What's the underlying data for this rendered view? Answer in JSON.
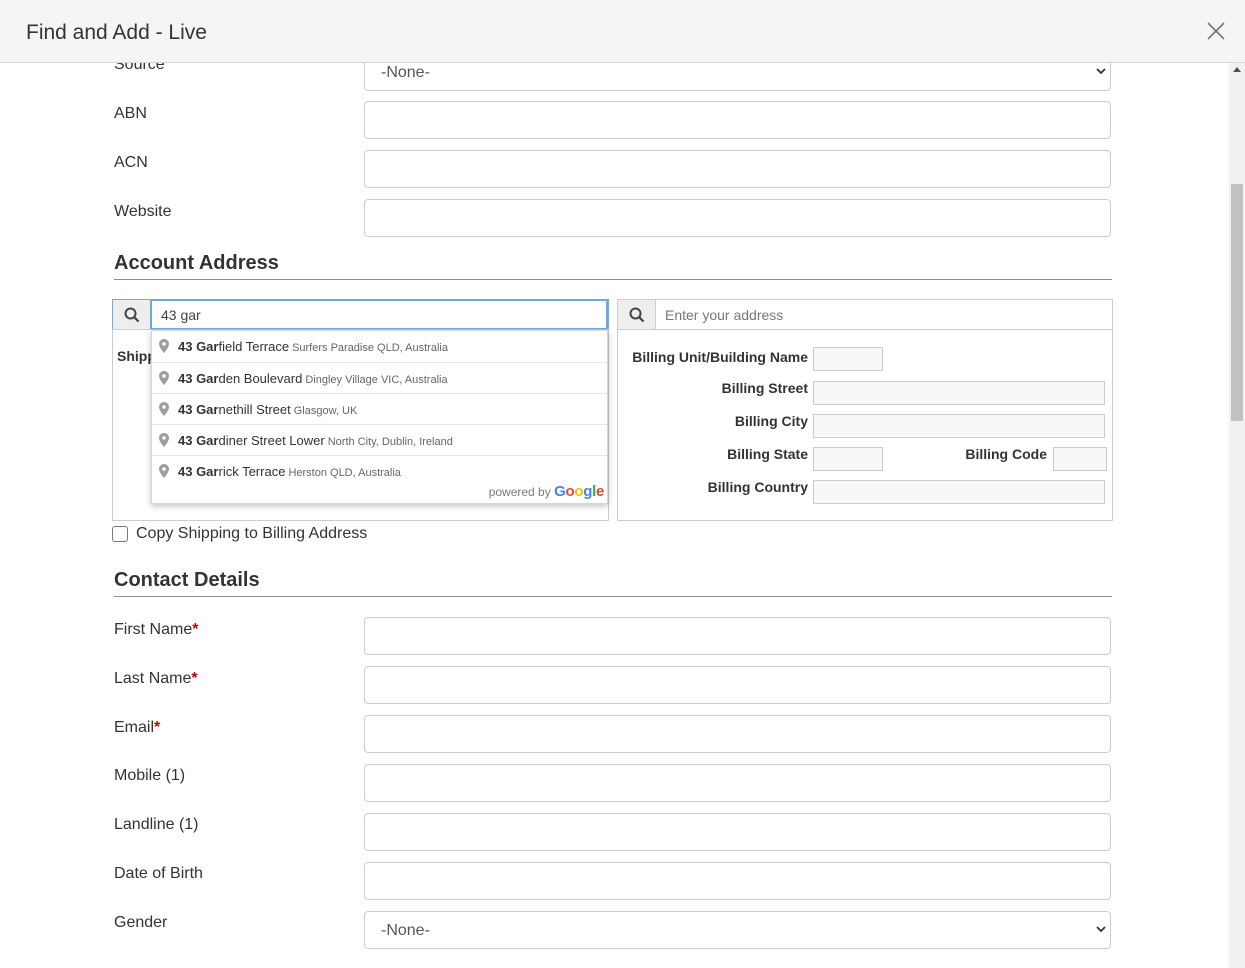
{
  "modal": {
    "title": "Find and Add - Live"
  },
  "account_fields": [
    {
      "label": "Source",
      "type": "select",
      "value": "-None-"
    },
    {
      "label": "ABN",
      "type": "text",
      "value": ""
    },
    {
      "label": "ACN",
      "type": "text",
      "value": ""
    },
    {
      "label": "Website",
      "type": "text",
      "value": ""
    }
  ],
  "account_address": {
    "heading": "Account Address",
    "shipping_search": {
      "value": "43 gar",
      "placeholder": ""
    },
    "billing_search": {
      "value": "",
      "placeholder": "Enter your address"
    },
    "shipping_label_partial": "Shipp",
    "billing_fields": {
      "unit": "Billing Unit/Building Name",
      "street": "Billing Street",
      "city": "Billing City",
      "state": "Billing State",
      "code": "Billing Code",
      "country": "Billing Country"
    },
    "suggestions": [
      {
        "typed": "43 Gar",
        "rest": "field Terrace",
        "secondary": "Surfers Paradise QLD, Australia"
      },
      {
        "typed": "43 Gar",
        "rest": "den Boulevard",
        "secondary": "Dingley Village VIC, Australia"
      },
      {
        "typed": "43 Gar",
        "rest": "nethill Street",
        "secondary": "Glasgow, UK"
      },
      {
        "typed": "43 Gar",
        "rest": "diner Street Lower",
        "secondary": "North City, Dublin, Ireland"
      },
      {
        "typed": "43 Gar",
        "rest": "rick Terrace",
        "secondary": "Herston QLD, Australia"
      }
    ],
    "powered_by": "powered by",
    "google_letters": [
      "G",
      "o",
      "o",
      "g",
      "l",
      "e"
    ],
    "google_colors": [
      "#4285F4",
      "#EA4335",
      "#FBBC05",
      "#4285F4",
      "#34A853",
      "#EA4335"
    ],
    "copy_checkbox": {
      "label": "Copy Shipping to Billing Address",
      "checked": false
    }
  },
  "contact_details": {
    "heading": "Contact Details",
    "fields": [
      {
        "label": "First Name",
        "required": true,
        "type": "text"
      },
      {
        "label": "Last Name",
        "required": true,
        "type": "text"
      },
      {
        "label": "Email",
        "required": true,
        "type": "text"
      },
      {
        "label": "Mobile (1)",
        "required": false,
        "type": "text"
      },
      {
        "label": "Landline (1)",
        "required": false,
        "type": "text"
      },
      {
        "label": "Date of Birth",
        "required": false,
        "type": "text"
      },
      {
        "label": "Gender",
        "required": false,
        "type": "select",
        "value": "-None-"
      }
    ],
    "required_marker": "*"
  },
  "icons": {
    "close": "close-icon",
    "search": "search-icon",
    "pin": "map-pin-icon",
    "chevron": "chevron-down-icon"
  },
  "colors": {
    "header_bg": "#f5f5f5",
    "required": "#c00000",
    "focus_border": "#6da7dc"
  }
}
